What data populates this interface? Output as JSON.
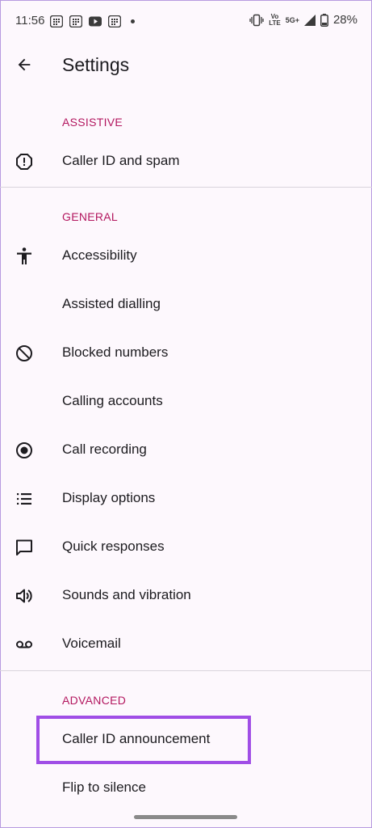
{
  "status_bar": {
    "time": "11:56",
    "network_top": "Vo",
    "network_bottom": "LTE",
    "network_type": "5G+",
    "battery": "28%"
  },
  "app_bar": {
    "title": "Settings",
    "back_icon": "arrow-back-icon"
  },
  "sections": {
    "assistive": {
      "header": "ASSISTIVE",
      "items": [
        {
          "label": "Caller ID and spam",
          "icon": "alert-octagon-icon"
        }
      ]
    },
    "general": {
      "header": "GENERAL",
      "items": [
        {
          "label": "Accessibility",
          "icon": "accessibility-icon"
        },
        {
          "label": "Assisted dialling",
          "icon": ""
        },
        {
          "label": "Blocked numbers",
          "icon": "block-icon"
        },
        {
          "label": "Calling accounts",
          "icon": ""
        },
        {
          "label": "Call recording",
          "icon": "record-icon"
        },
        {
          "label": "Display options",
          "icon": "list-icon"
        },
        {
          "label": "Quick responses",
          "icon": "chat-bubble-icon"
        },
        {
          "label": "Sounds and vibration",
          "icon": "volume-icon"
        },
        {
          "label": "Voicemail",
          "icon": "voicemail-icon"
        }
      ]
    },
    "advanced": {
      "header": "ADVANCED",
      "items": [
        {
          "label": "Caller ID announcement",
          "icon": ""
        },
        {
          "label": "Flip to silence",
          "icon": ""
        }
      ]
    }
  },
  "colors": {
    "background": "#fdf8fd",
    "section_header": "#b3175f",
    "highlight": "#a04ee6",
    "text": "#1c1b1f",
    "divider": "#d9d4dc"
  }
}
